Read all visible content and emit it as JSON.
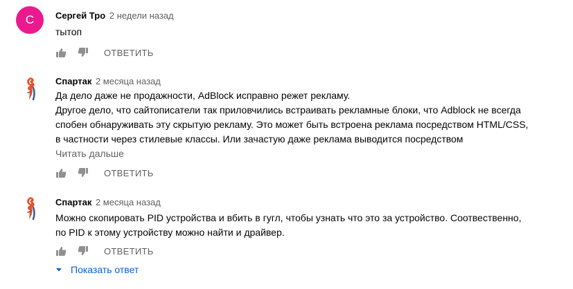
{
  "comments": [
    {
      "author": "Сергей Тро",
      "time": "2 недели назад",
      "avatar_letter": "С",
      "avatar_color": "#ea1a8e",
      "lines": [
        "тытоп"
      ],
      "reply_label": "ОТВЕТИТЬ"
    },
    {
      "author": "Спартак",
      "time": "2 месяца назад",
      "avatar": "spartak-logo-icon",
      "lines": [
        "Да дело даже не продажности, AdBlock исправно режет рекламу.",
        "Другое дело, что сайтописатели так приловчились встраивать рекламные блоки, что Adblock не всегда",
        "спобен обнаруживать эту скрытую рекламу. Это может быть встроена реклама посредством HTML/CSS,",
        "в частности через стилевые классы. Или зачастую даже реклама выводится посредством"
      ],
      "read_more": "Читать дальше",
      "reply_label": "ОТВЕТИТЬ"
    },
    {
      "author": "Спартак",
      "time": "2 месяца назад",
      "avatar": "spartak-logo-icon",
      "lines": [
        "Можно скопировать PID устройства и вбить в гугл, чтобы узнать что это за устройство. Соотвественно,",
        "по PID к этому устройству можно найти и драйвер."
      ],
      "reply_label": "ОТВЕТИТЬ",
      "show_replies": "Показать ответ"
    }
  ],
  "colors": {
    "link": "#065fd4",
    "muted": "#606060",
    "icon": "#909090"
  }
}
